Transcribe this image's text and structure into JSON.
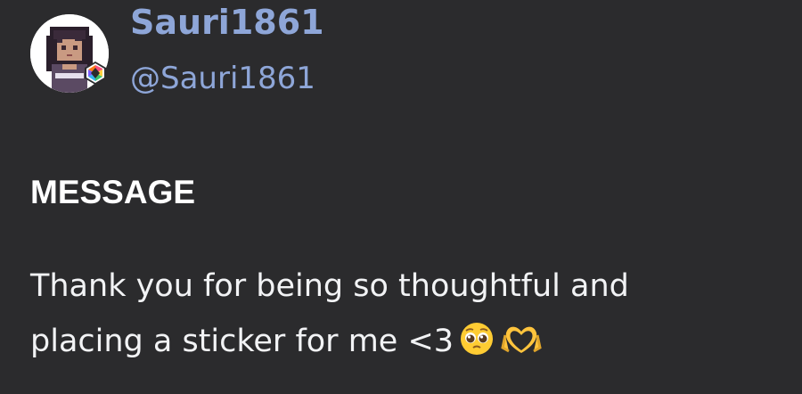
{
  "profile": {
    "display_name": "Sauri1861",
    "username": "@Sauri1861",
    "avatar": "pixel-art-girl-avatar",
    "badge": "nitro-hexagon-badge"
  },
  "message_section": {
    "heading": "MESSAGE",
    "line1": "Thank you for being so thoughtful and",
    "line2": "placing a sticker for me <3",
    "emojis": [
      "pleading-face-emoji",
      "heart-hands-emoji"
    ]
  },
  "colors": {
    "background": "#2b2b2d",
    "name_accent": "#8ea6d8",
    "text": "#f2f3f5"
  }
}
